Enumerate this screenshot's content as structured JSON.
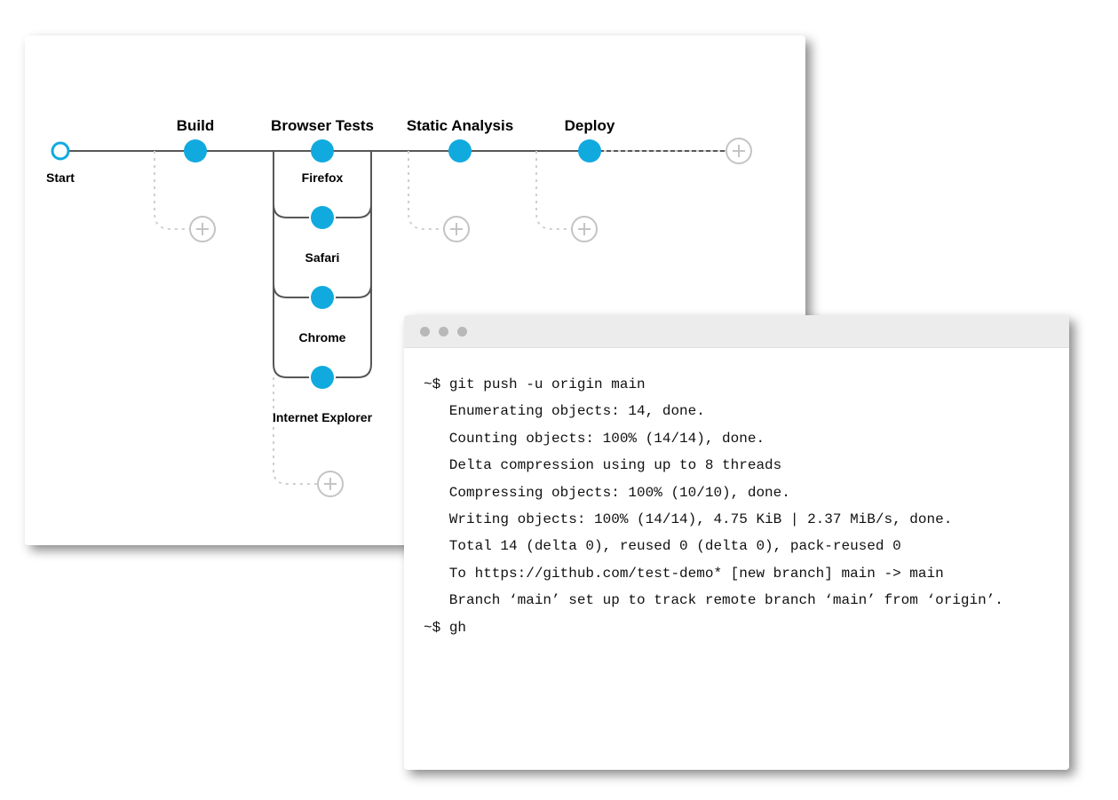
{
  "pipeline": {
    "start_label": "Start",
    "stages": [
      {
        "label": "Build"
      },
      {
        "label": "Browser Tests"
      },
      {
        "label": "Static Analysis"
      },
      {
        "label": "Deploy"
      }
    ],
    "browser_tests": [
      "Firefox",
      "Safari",
      "Chrome",
      "Internet Explorer"
    ]
  },
  "terminal": {
    "prompt": "~$",
    "command1": "git push -u origin main",
    "output": [
      "Enumerating objects: 14, done.",
      "Counting objects: 100% (14/14), done.",
      "Delta compression using up to 8 threads",
      "Compressing objects: 100% (10/10), done.",
      "Writing objects: 100% (14/14), 4.75 KiB | 2.37 MiB/s, done.",
      "Total 14 (delta 0), reused 0 (delta 0), pack-reused 0",
      "To https://github.com/test-demo* [new branch] main -> main",
      "Branch ‘main’ set up to track remote branch ‘main’ from ‘origin’."
    ],
    "command2": "gh"
  }
}
